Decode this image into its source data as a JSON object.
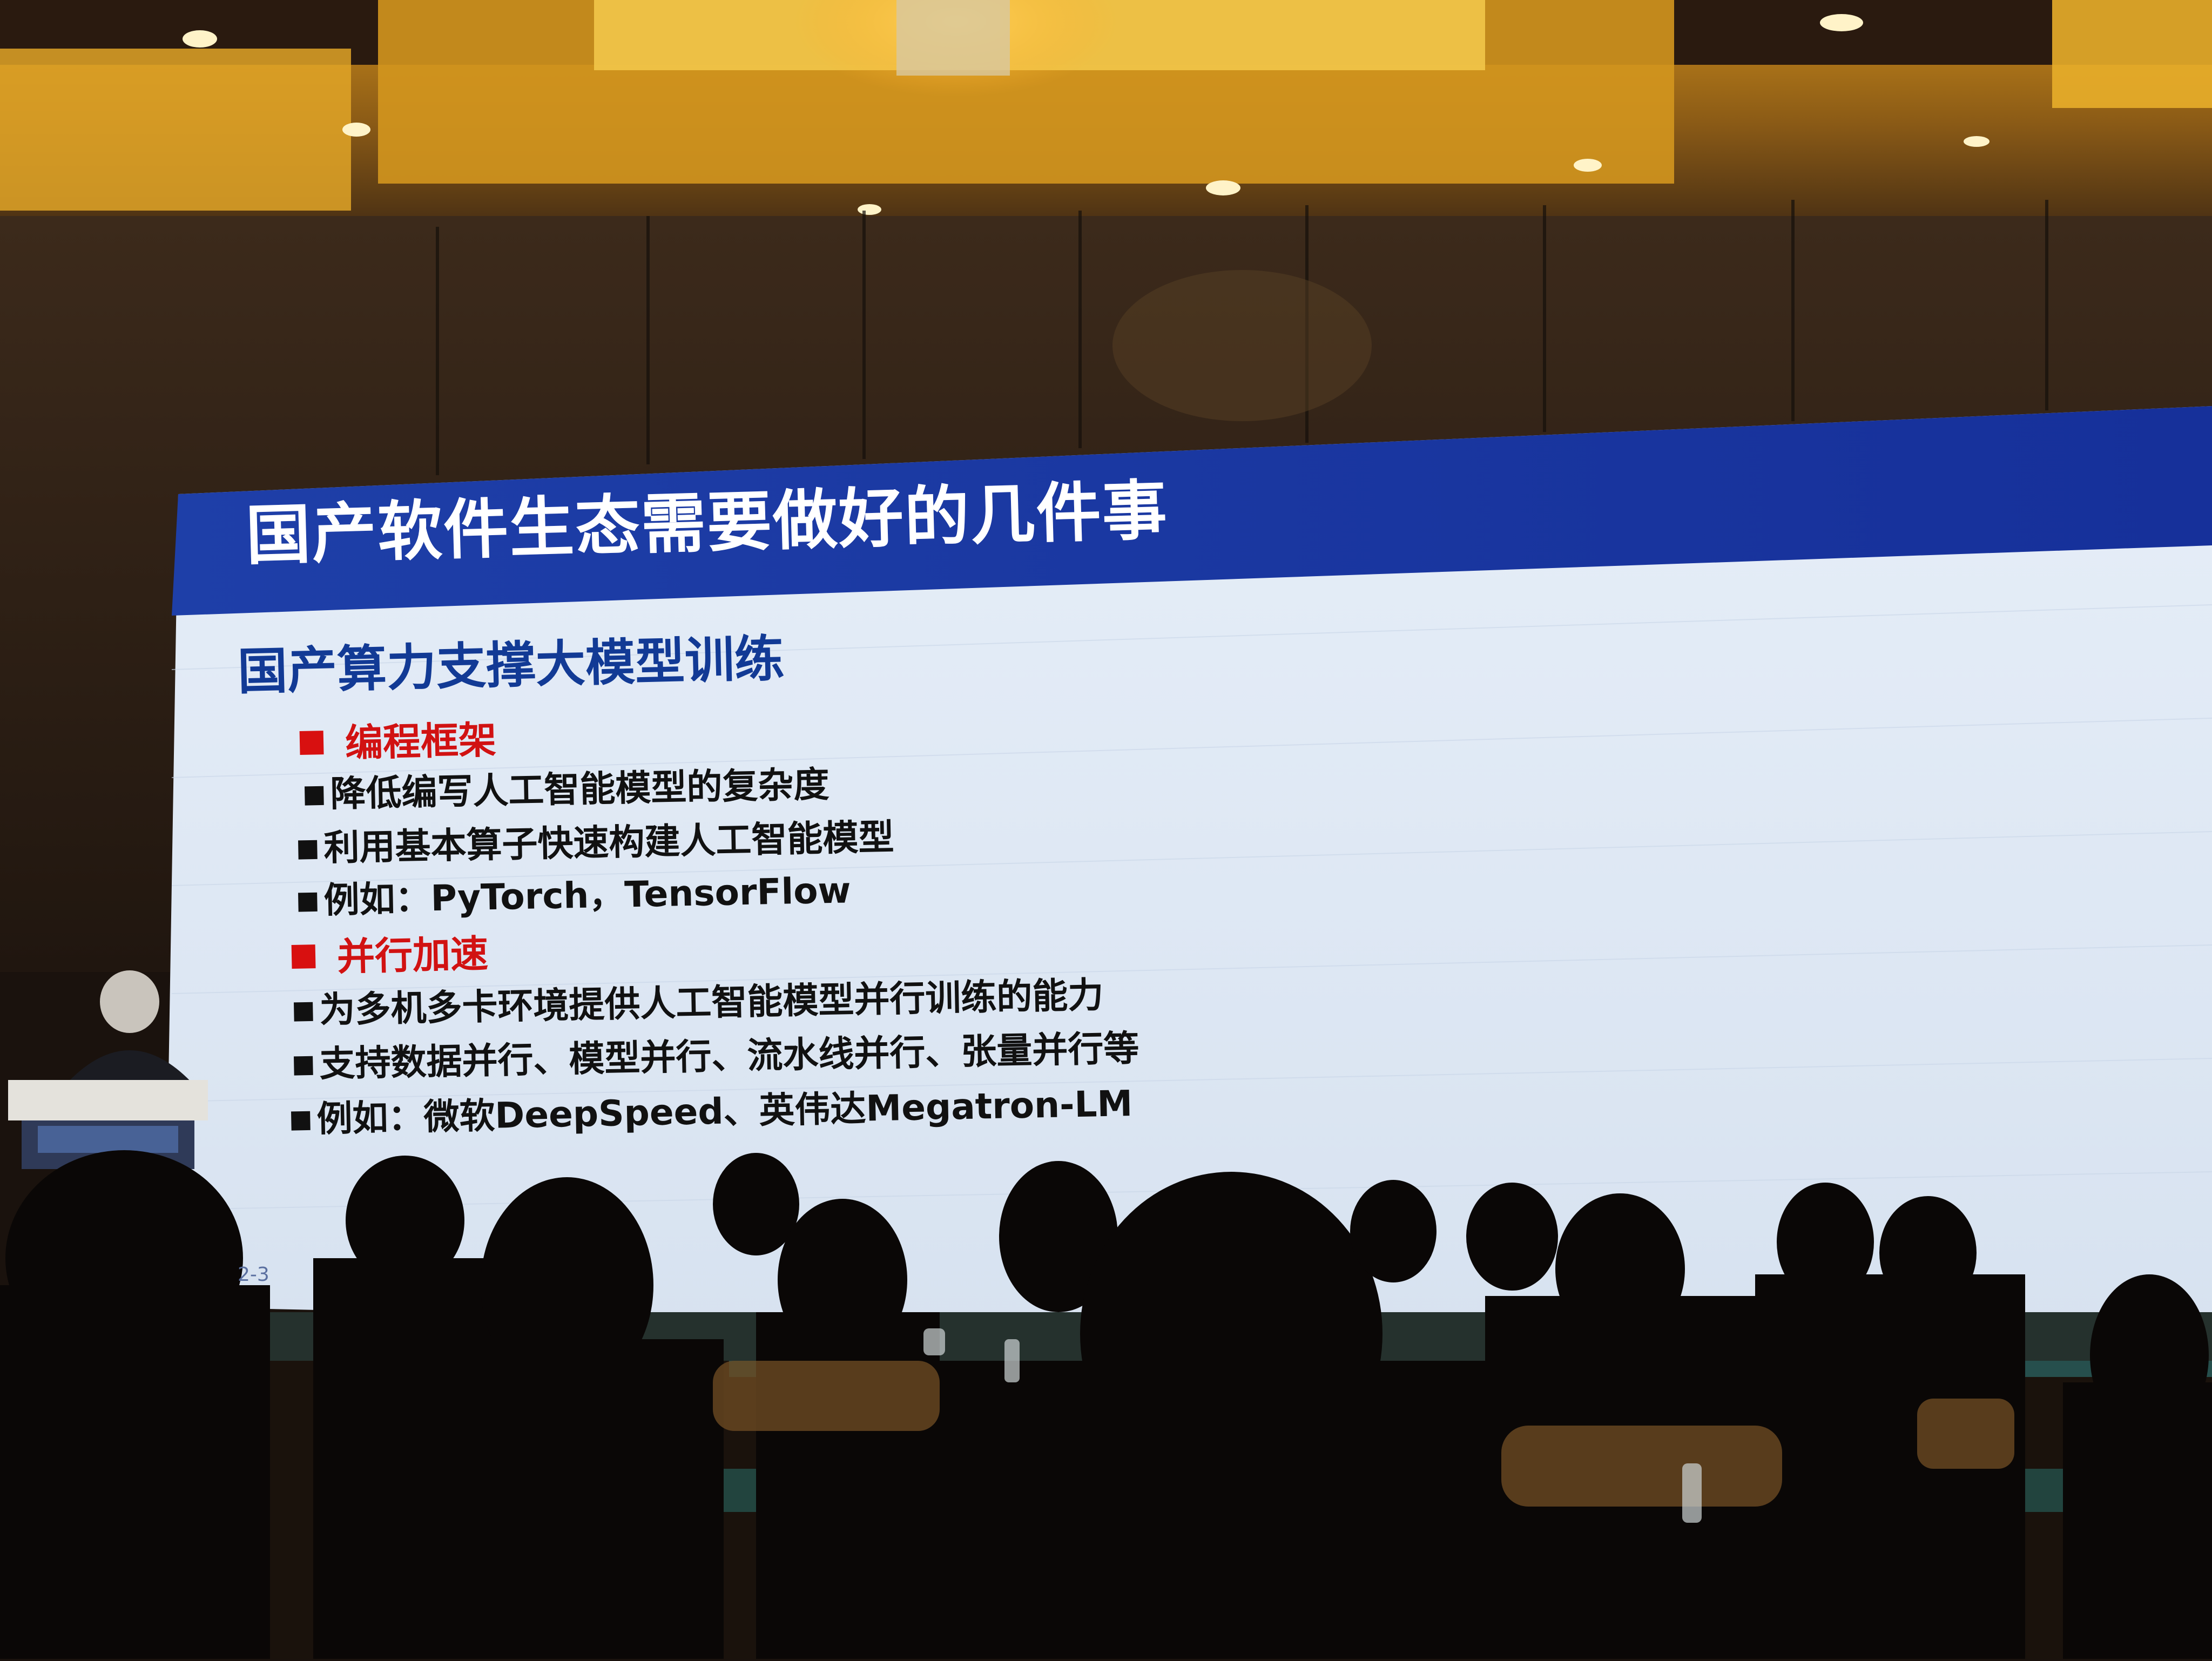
{
  "slide": {
    "title": "国产软件生态需要做好的几件事",
    "subtitle": "国产算力支撑大模型训练",
    "sections": [
      {
        "heading": "编程框架",
        "items": [
          "降低编写人工智能模型的复杂度",
          "利用基本算子快速构建人工智能模型",
          "例如：PyTorch，TensorFlow"
        ]
      },
      {
        "heading": "并行加速",
        "items": [
          "为多机多卡环境提供人工智能模型并行训练的能力",
          "支持数据并行、模型并行、流水线并行、张量并行等",
          "例如：微软DeepSpeed、英伟达Megatron-LM"
        ]
      }
    ],
    "page_number": "2-3",
    "colors": {
      "title_bar": "#1a3ba8",
      "title_text": "#ffffff",
      "subtitle_text": "#123a95",
      "section_heading": "#d11212",
      "section_bullet": "#d81010",
      "body_text": "#111111"
    }
  }
}
